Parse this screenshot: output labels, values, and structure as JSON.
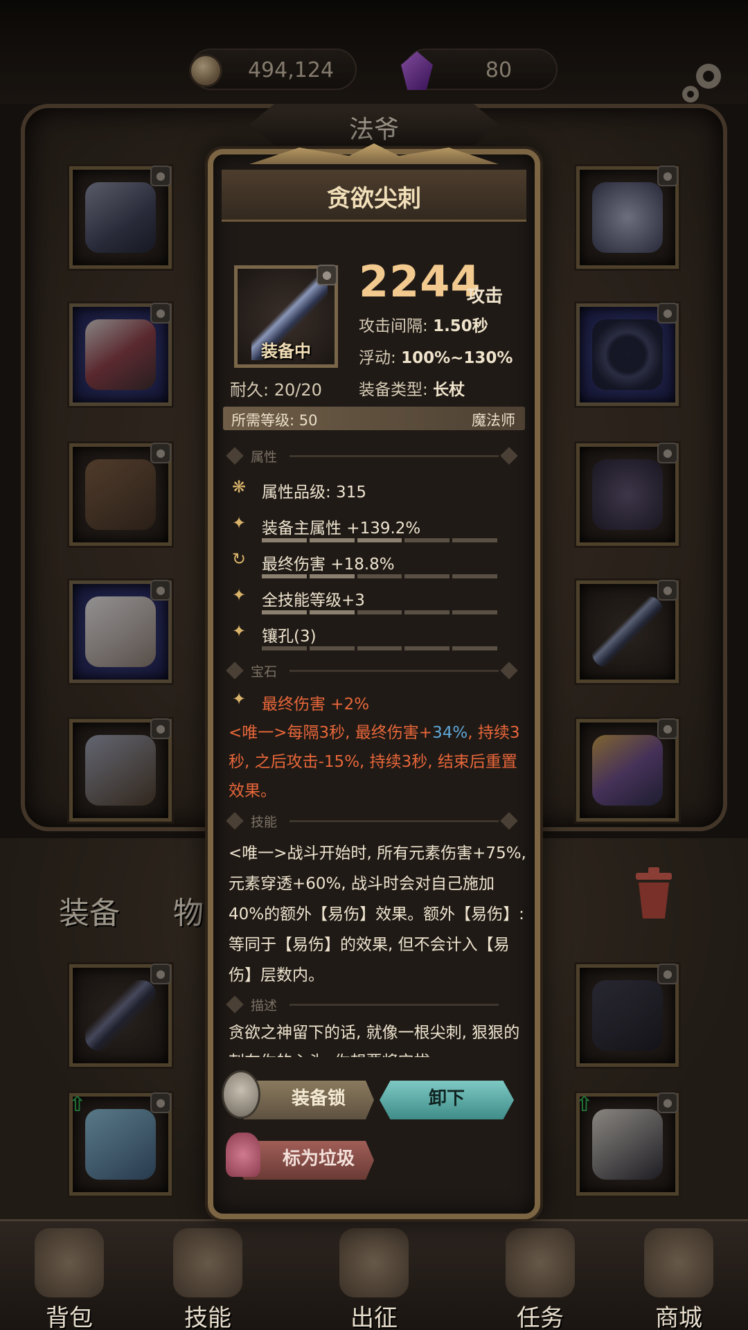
{
  "currency": {
    "coins": "494,124",
    "gems": "80"
  },
  "character": {
    "name": "法爷"
  },
  "background_labels": {
    "equipment": "装备",
    "items": "物品"
  },
  "icons": {
    "coin": "coin-icon",
    "gem": "gem-icon",
    "settings": "gear-icon",
    "lock": "lock-icon",
    "trash": "trash-icon",
    "upgrade": "arrow-up-icon"
  },
  "item": {
    "name": "贪欲尖刺",
    "status": "装备中",
    "durability_label": "耐久:",
    "durability_value": "20/20",
    "attack_value": "2244",
    "attack_unit": "攻击",
    "attack_interval_label": "攻击间隔:",
    "attack_interval_value": "1.50秒",
    "fluctuation_label": "浮动:",
    "fluctuation_value": "100%~130%",
    "type_label": "装备类型:",
    "type_value": "长杖",
    "required_level": "所需等级: 50",
    "required_class": "魔法师"
  },
  "sections": {
    "attributes": "属性",
    "gems": "宝石",
    "skills": "技能",
    "description": "描述"
  },
  "attributes": [
    {
      "icon": "crest-icon",
      "text": "属性品级: 315",
      "bar": false
    },
    {
      "icon": "star-icon",
      "text": "装备主属性 +139.2%",
      "bar": true,
      "fill": 3
    },
    {
      "icon": "refresh-icon",
      "text": "最终伤害 +18.8%",
      "bar": true,
      "fill": 2
    },
    {
      "icon": "star-icon",
      "text": "全技能等级+3",
      "bar": true,
      "fill": 2
    },
    {
      "icon": "star-icon",
      "text": "镶孔(3)",
      "bar": true,
      "fill": 0
    }
  ],
  "gem_bonus": "最终伤害 +2%",
  "unique_effect": {
    "part1": "<唯一>每隔3秒, 最终伤害+",
    "highlight": "34%",
    "part2": ", 持续3秒, 之后攻击-15%, 持续3秒, 结束后重置效果。"
  },
  "skill_text": "<唯一>战斗开始时, 所有元素伤害+75%, 元素穿透+60%, 战斗时会对自己施加40%的额外【易伤】效果。额外【易伤】: 等同于【易伤】的效果, 但不会计入【易伤】层数内。",
  "description_text": "贪欲之神留下的话, 就像一根尖刺, 狠狠的刺在你的心头, 你想要将它拔",
  "buttons": {
    "lock": "装备锁",
    "unequip": "卸下",
    "trash": "标为垃圾"
  },
  "bottom_nav": [
    {
      "label": "背包",
      "icon": "backpack-icon"
    },
    {
      "label": "技能",
      "icon": "skill-book-icon"
    },
    {
      "label": "出征",
      "icon": "battle-map-icon"
    },
    {
      "label": "任务",
      "icon": "quest-scroll-icon"
    },
    {
      "label": "商城",
      "icon": "shop-icon"
    }
  ],
  "colors": {
    "accent_gold": "#f2c98e",
    "unique_red": "#e8673a",
    "highlight_blue": "#5fa8d8",
    "unequip_teal": "#7ec9c4"
  }
}
